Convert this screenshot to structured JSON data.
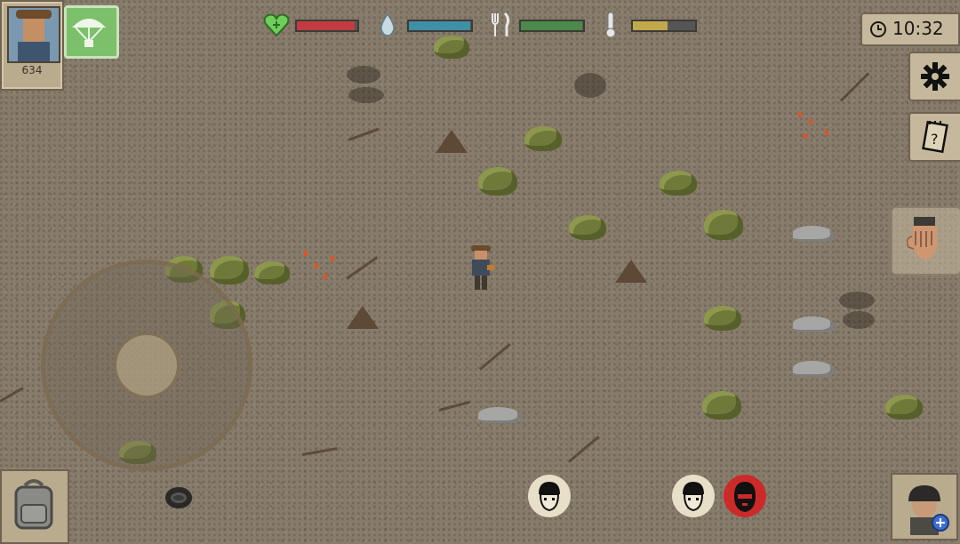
{
  "hud": {
    "player_count": "634",
    "clock": "10:32",
    "stats": {
      "health": 0.95,
      "water": 0.98,
      "food": 0.98,
      "temperature": 0.55
    }
  },
  "colors": {
    "health": "#c23b40",
    "water": "#3f8fa6",
    "food": "#4b8a4a",
    "temperature": "#c1a84a",
    "enemy": "#cc2a2a"
  },
  "icons": {
    "heart": "heart-icon",
    "water": "water-drop-icon",
    "food": "fork-knife-icon",
    "temperature": "thermometer-icon",
    "settings": "gear-icon",
    "journal": "journal-icon",
    "interact": "hand-icon",
    "inventory": "backpack-icon",
    "airdrop": "parachute-icon",
    "clock": "clock-icon"
  },
  "players_nearby": [
    {
      "kind": "neutral"
    },
    {
      "kind": "neutral"
    },
    {
      "kind": "hostile"
    }
  ]
}
